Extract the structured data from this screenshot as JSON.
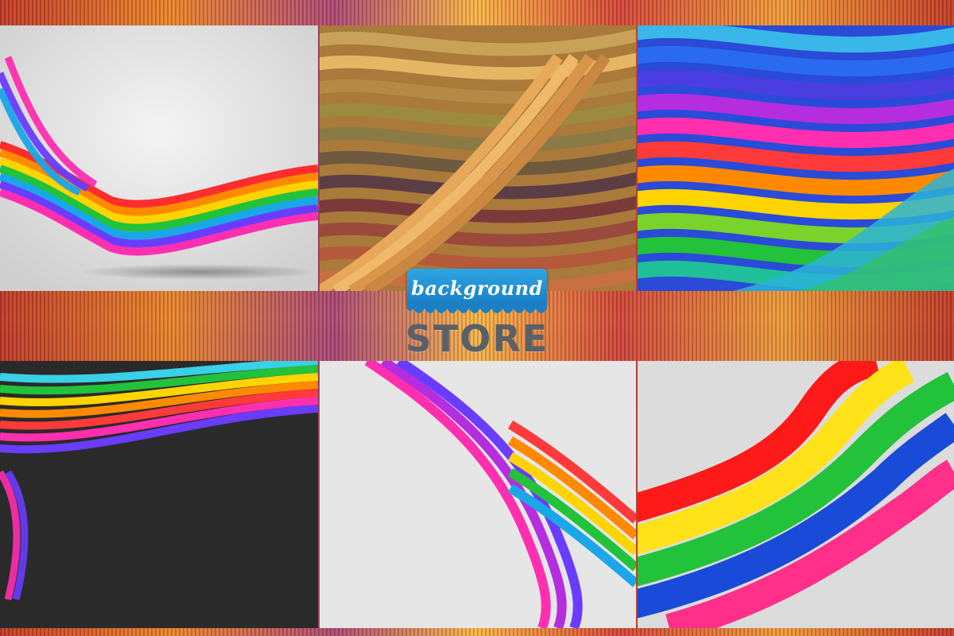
{
  "logo": {
    "top_word": "background",
    "bottom_word": "STORE"
  },
  "tiles": [
    {
      "style": "rainbow ribbon on light gray"
    },
    {
      "style": "golden brown waves"
    },
    {
      "style": "rainbow waves on blue"
    },
    {
      "style": "rainbow ribbon on dark gray"
    },
    {
      "style": "rainbow ribbon on light gray texture"
    },
    {
      "style": "flat rainbow bands on light gray"
    }
  ],
  "colors": {
    "brand_blue": "#2ea6e4",
    "store_gray": "#5b6066"
  }
}
